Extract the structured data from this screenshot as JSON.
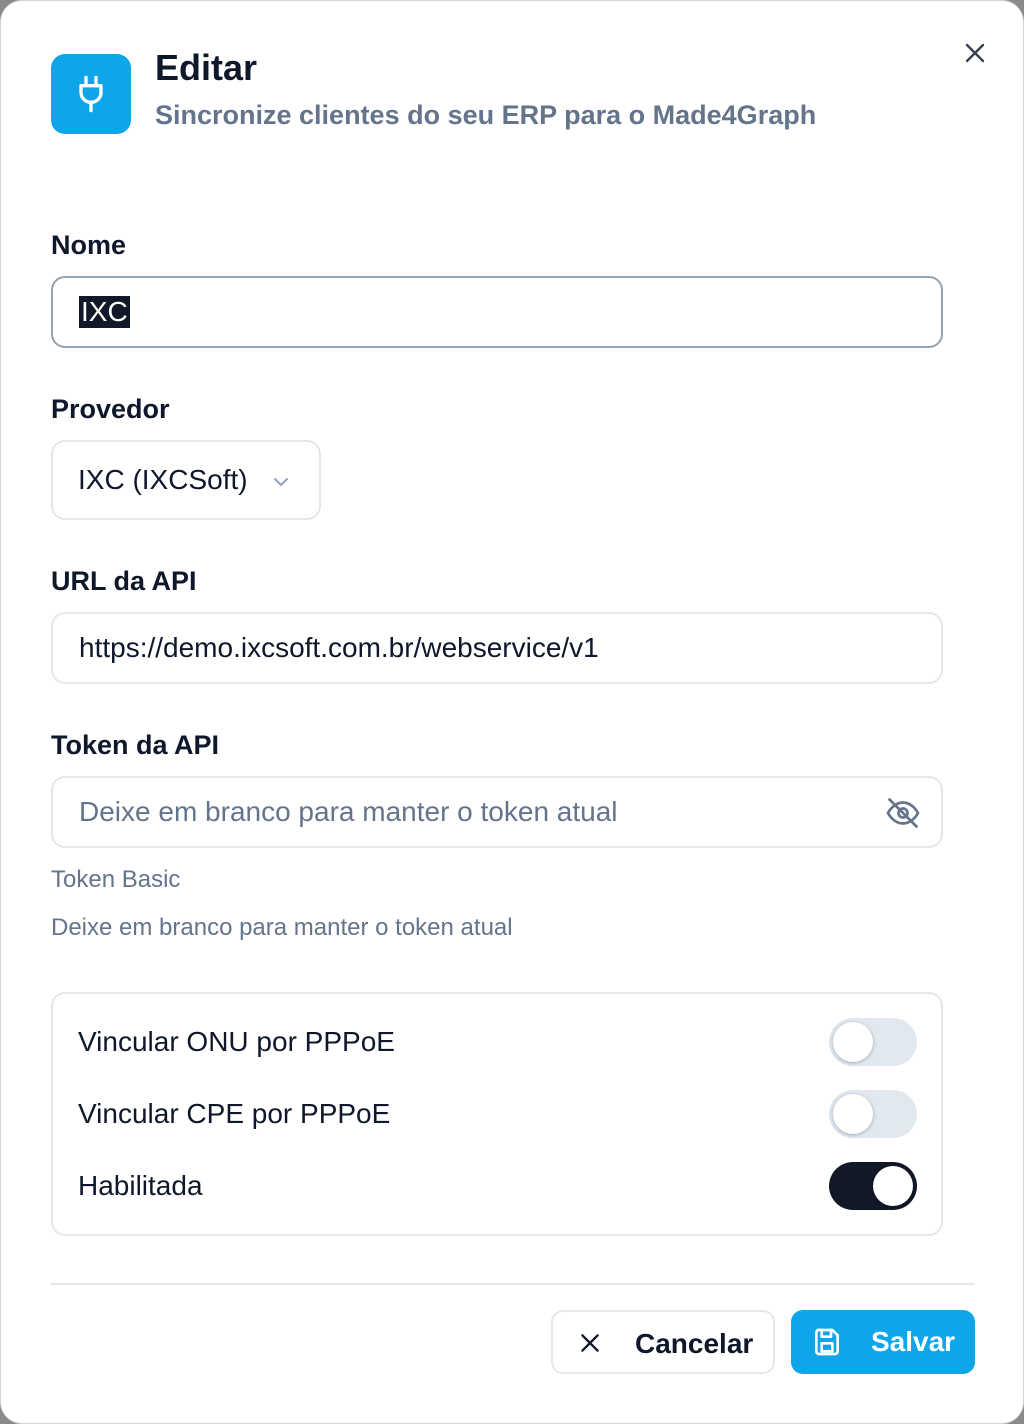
{
  "dialog": {
    "title": "Editar",
    "subtitle": "Sincronize clientes do seu ERP para o Made4Graph",
    "header_icon": "plug-icon",
    "close_icon": "close-icon"
  },
  "form": {
    "name": {
      "label": "Nome",
      "value": "IXC"
    },
    "provider": {
      "label": "Provedor",
      "selected": "IXC (IXCSoft)"
    },
    "api_url": {
      "label": "URL da API",
      "value": "https://demo.ixcsoft.com.br/webservice/v1"
    },
    "api_token": {
      "label": "Token da API",
      "value": "",
      "placeholder": "Deixe em branco para manter o token atual",
      "visibility_icon": "eye-off-icon",
      "hint1": "Token Basic",
      "hint2": "Deixe em branco para manter o token atual"
    },
    "toggles": [
      {
        "label": "Vincular ONU por PPPoE",
        "on": false
      },
      {
        "label": "Vincular CPE por PPPoE",
        "on": false
      },
      {
        "label": "Habilitada",
        "on": true
      }
    ]
  },
  "footer": {
    "cancel_label": "Cancelar",
    "save_label": "Salvar"
  },
  "colors": {
    "accent": "#0ea5e9",
    "switch_on": "#111827",
    "switch_off": "#e2e8f0",
    "muted_text": "#64748b"
  }
}
